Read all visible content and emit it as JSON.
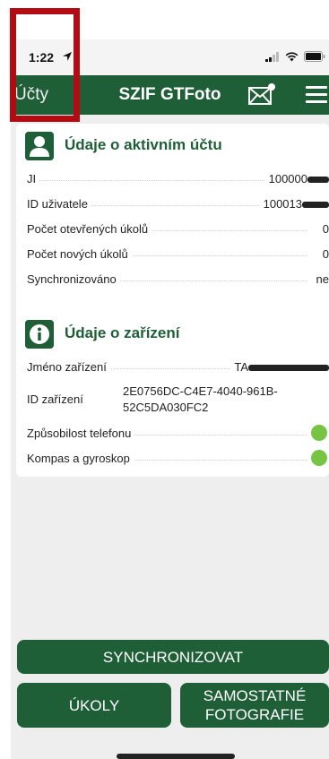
{
  "status_bar": {
    "time": "1:22"
  },
  "nav": {
    "back_label": "Účty",
    "title": "SZIF GTFoto"
  },
  "account_card": {
    "title": "Údaje o aktivním účtu",
    "rows": [
      {
        "label": "JI",
        "value": "100000"
      },
      {
        "label": "ID uživatele",
        "value": "100013"
      },
      {
        "label": "Počet otevřených úkolů",
        "value": "0"
      },
      {
        "label": "Počet nových úkolů",
        "value": "0"
      },
      {
        "label": "Synchronizováno",
        "value": "ne"
      }
    ]
  },
  "device_card": {
    "title": "Údaje o zařízení",
    "rows": [
      {
        "label": "Jméno zařízení",
        "value": "TA"
      },
      {
        "label": "ID zařízení",
        "value": "2E0756DC-C4E7-4040-961B-52C5DA030FC2"
      },
      {
        "label": "Způsobilost telefonu",
        "status": "ok"
      },
      {
        "label": "Kompas a gyroskop",
        "status": "ok"
      }
    ]
  },
  "buttons": {
    "sync": "SYNCHRONIZOVAT",
    "tasks": "ÚKOLY",
    "photos": "SAMOSTATNÉ FOTOGRAFIE"
  },
  "colors": {
    "brand_green": "#1f5f38",
    "status_ok": "#76c442",
    "highlight": "#b30b13"
  },
  "icons": {
    "account": "user-icon",
    "device": "info-icon",
    "mail": "mail-icon",
    "menu": "hamburger-menu-icon"
  }
}
